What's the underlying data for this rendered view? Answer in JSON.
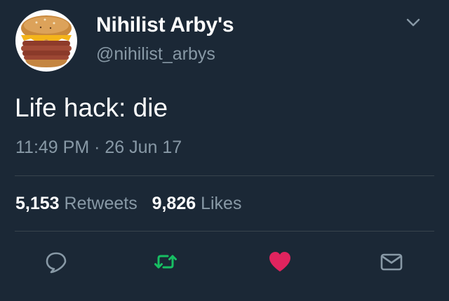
{
  "tweet": {
    "author": {
      "display_name": "Nihilist Arby's",
      "handle": "@nihilist_arbys"
    },
    "text": "Life hack: die",
    "time": "11:49 PM",
    "separator": " · ",
    "date": "26 Jun 17",
    "stats": {
      "retweets_count": "5,153",
      "retweets_label": "Retweets",
      "likes_count": "9,826",
      "likes_label": "Likes"
    }
  },
  "actions": {
    "reply_icon": "reply-icon",
    "retweet_icon": "retweet-icon",
    "like_icon": "heart-icon",
    "dm_icon": "envelope-icon"
  },
  "colors": {
    "background": "#1b2836",
    "secondary_text": "#8899a6",
    "divider": "#38444d",
    "retweet_green": "#17bf63",
    "like_red": "#e0245e"
  }
}
